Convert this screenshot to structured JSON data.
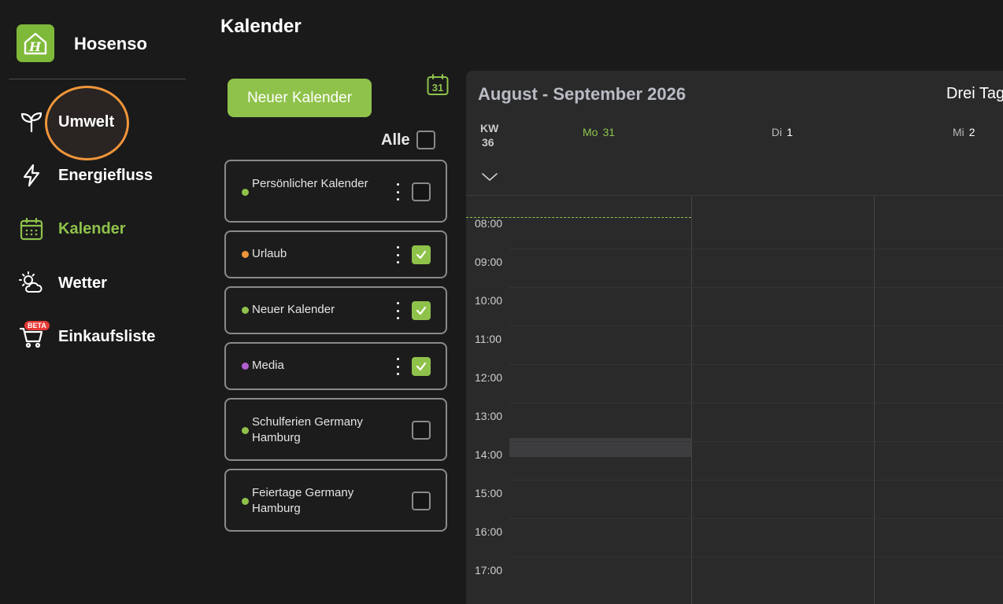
{
  "app": {
    "brand": "Hosenso"
  },
  "sidebar": {
    "items": [
      {
        "label": "Umwelt",
        "icon": "sprout-icon"
      },
      {
        "label": "Energiefluss",
        "icon": "lightning-icon"
      },
      {
        "label": "Kalender",
        "icon": "calendar-icon",
        "active": true
      },
      {
        "label": "Wetter",
        "icon": "sun-cloud-icon"
      },
      {
        "label": "Einkaufsliste",
        "icon": "cart-icon",
        "badge": "BETA"
      }
    ]
  },
  "header": {
    "title": "Kalender"
  },
  "calendars": {
    "new_button": "Neuer Kalender",
    "today_icon_day": "31",
    "all_label": "Alle",
    "all_checked": false,
    "items": [
      {
        "name": "Persönlicher Kalender",
        "color": "#8fc24a",
        "checked": false,
        "has_menu": true
      },
      {
        "name": "Urlaub",
        "color": "#f0953a",
        "checked": true,
        "has_menu": true
      },
      {
        "name": "Neuer Kalender",
        "color": "#8fc24a",
        "checked": true,
        "has_menu": true
      },
      {
        "name": "Media",
        "color": "#b05fd0",
        "checked": true,
        "has_menu": true
      },
      {
        "name": "Schulferien Germany Hamburg",
        "color": "#8fc24a",
        "checked": false,
        "has_menu": false
      },
      {
        "name": "Feiertage Germany Hamburg",
        "color": "#8fc24a",
        "checked": false,
        "has_menu": false
      }
    ]
  },
  "grid": {
    "range_title": "August - September 2026",
    "view_label": "Drei Tage",
    "kw_label": "KW",
    "kw_number": "36",
    "days": [
      {
        "weekday": "Mo",
        "day": "31",
        "today": true
      },
      {
        "weekday": "Di",
        "day": "1",
        "today": false
      },
      {
        "weekday": "Mi",
        "day": "2",
        "today": false
      }
    ],
    "hours": [
      "08:00",
      "09:00",
      "10:00",
      "11:00",
      "12:00",
      "13:00",
      "14:00",
      "15:00",
      "16:00",
      "17:00"
    ]
  },
  "colors": {
    "accent": "#8fc24a",
    "highlight": "#f0953a",
    "beta": "#e53935"
  }
}
